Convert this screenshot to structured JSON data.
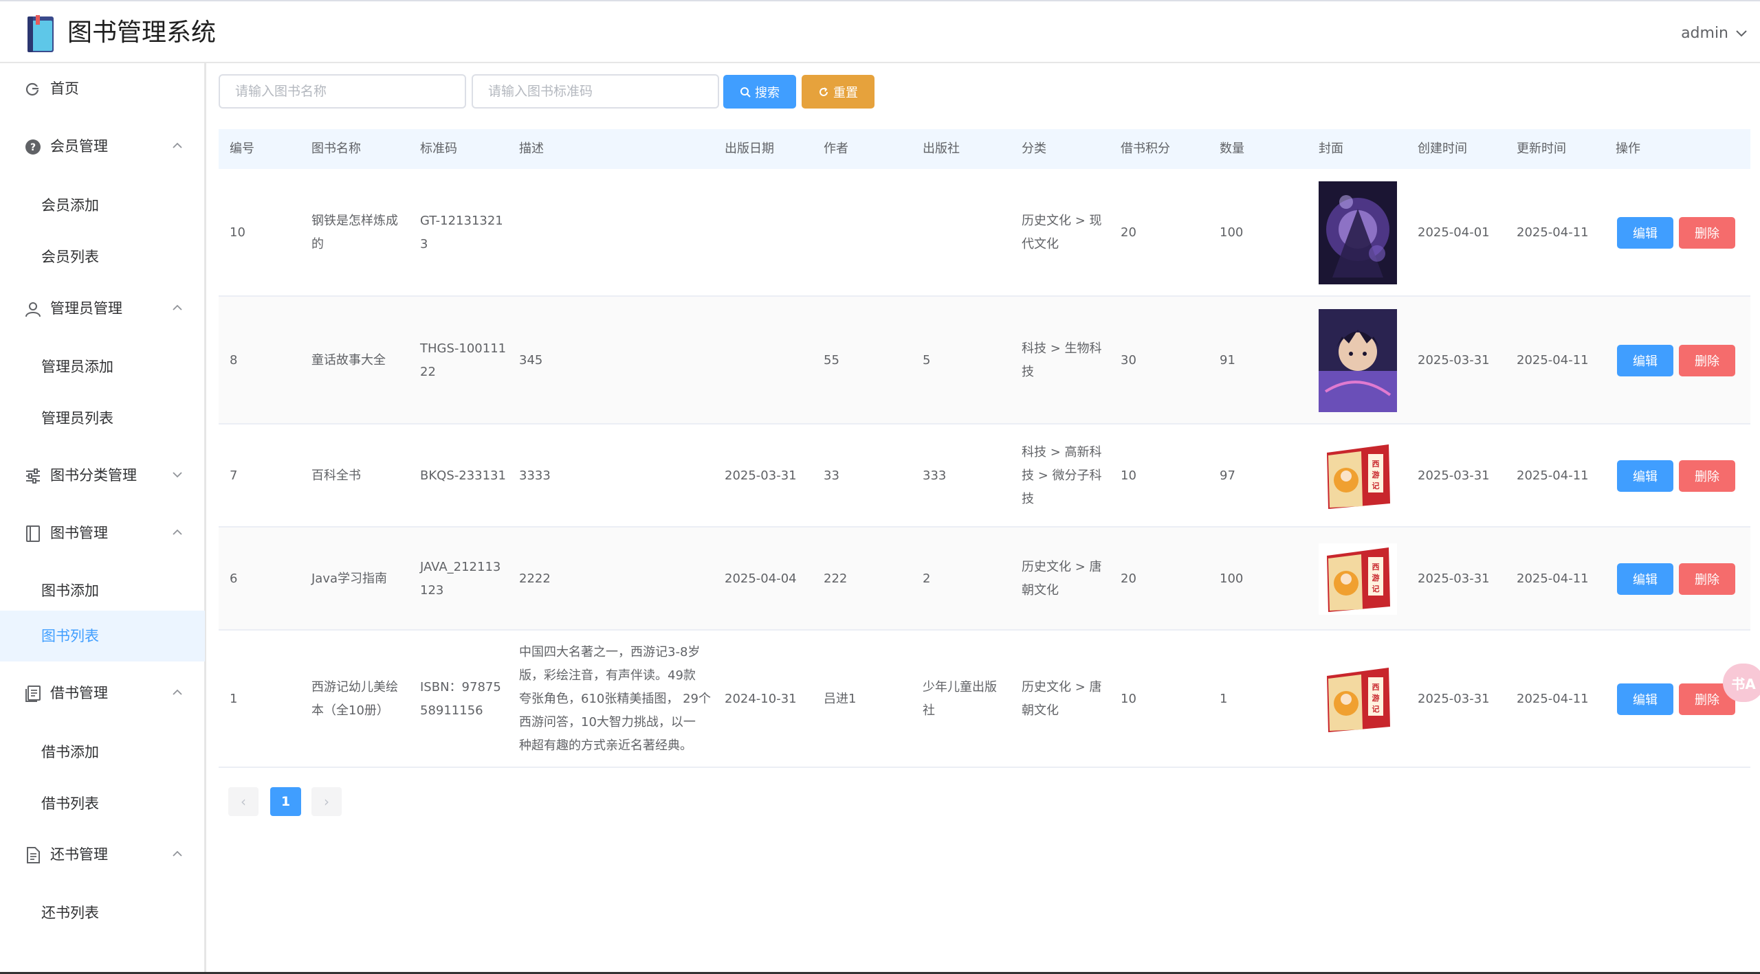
{
  "app": {
    "title": "图书管理系统",
    "user": "admin"
  },
  "sidebar": {
    "home": "首页",
    "groups": [
      {
        "label": "会员管理",
        "icon": "question-circle-icon",
        "items": [
          "会员添加",
          "会员列表"
        ]
      },
      {
        "label": "管理员管理",
        "icon": "user-icon",
        "items": [
          "管理员添加",
          "管理员列表"
        ]
      },
      {
        "label": "图书分类管理",
        "icon": "sliders-icon",
        "items": []
      },
      {
        "label": "图书管理",
        "icon": "notebook-icon",
        "items": [
          "图书添加",
          "图书列表"
        ]
      },
      {
        "label": "借书管理",
        "icon": "document-list-icon",
        "items": [
          "借书添加",
          "借书列表"
        ]
      },
      {
        "label": "还书管理",
        "icon": "document-icon",
        "items": [
          "还书列表"
        ]
      }
    ],
    "active_item": "图书列表"
  },
  "search": {
    "name_placeholder": "请输入图书名称",
    "isbn_placeholder": "请输入图书标准码",
    "search_label": "搜索",
    "reset_label": "重置"
  },
  "table": {
    "headers": [
      "编号",
      "图书名称",
      "标准码",
      "描述",
      "出版日期",
      "作者",
      "出版社",
      "分类",
      "借书积分",
      "数量",
      "封面",
      "创建时间",
      "更新时间",
      "操作"
    ],
    "edit_label": "编辑",
    "delete_label": "删除",
    "rows": [
      {
        "id": "10",
        "name": [
          "钢铁是怎样炼成",
          "的"
        ],
        "isbn": [
          "GT-12131321",
          "3"
        ],
        "desc": [],
        "pub_date": "",
        "author": "",
        "publisher": [],
        "category": [
          "历史文化 > 现",
          "代文化"
        ],
        "points": "20",
        "qty": "100",
        "cover": "dark-purple-cover",
        "created": "2025-04-01",
        "updated": "2025-04-11"
      },
      {
        "id": "8",
        "name": [
          "童话故事大全"
        ],
        "isbn": [
          "THGS-100111",
          "22"
        ],
        "desc": [
          "345"
        ],
        "pub_date": "",
        "author": "55",
        "publisher": [
          "5"
        ],
        "category": [
          "科技 > 生物科",
          "技"
        ],
        "points": "30",
        "qty": "91",
        "cover": "anime-boy-cover",
        "created": "2025-03-31",
        "updated": "2025-04-11"
      },
      {
        "id": "7",
        "name": [
          "百科全书"
        ],
        "isbn": [
          "BKQS-233131"
        ],
        "desc": [
          "3333"
        ],
        "pub_date": "2025-03-31",
        "author": "33",
        "publisher": [
          "333"
        ],
        "category": [
          "科技 > 高新科",
          "技 > 微分子科",
          "技"
        ],
        "points": "10",
        "qty": "97",
        "cover": "xiyouji-box-cover",
        "created": "2025-03-31",
        "updated": "2025-04-11"
      },
      {
        "id": "6",
        "name": [
          "Java学习指南"
        ],
        "isbn": [
          "JAVA_212113",
          "123"
        ],
        "desc": [
          "2222"
        ],
        "pub_date": "2025-04-04",
        "author": "222",
        "publisher": [
          "2"
        ],
        "category": [
          "历史文化 > 唐",
          "朝文化"
        ],
        "points": "20",
        "qty": "100",
        "cover": "xiyouji-box-cover",
        "created": "2025-03-31",
        "updated": "2025-04-11"
      },
      {
        "id": "1",
        "name": [
          "西游记幼儿美绘",
          "本（全10册）"
        ],
        "isbn": [
          "ISBN：97875",
          "58911156"
        ],
        "desc": [
          "中国四大名著之一，西游记3-8岁",
          "版，彩绘注音，有声伴读。49款",
          "夸张角色，610张精美插图， 29个",
          "西游问答，10大智力挑战，以一",
          "种超有趣的方式亲近名著经典。"
        ],
        "pub_date": "2024-10-31",
        "author": "吕进1",
        "publisher": [
          "少年儿童出版",
          "社"
        ],
        "category": [
          "历史文化 > 唐",
          "朝文化"
        ],
        "points": "10",
        "qty": "1",
        "cover": "xiyouji-box-cover",
        "created": "2025-03-31",
        "updated": "2025-04-11"
      }
    ]
  },
  "pagination": {
    "current": "1",
    "prev": "‹",
    "next": "›"
  },
  "float_badge": "书A",
  "colors": {
    "primary": "#409eff",
    "warning": "#e6a23c",
    "danger": "#f56c6c",
    "active_bg": "#ecf5ff",
    "header_bg": "#f0f7ff"
  }
}
